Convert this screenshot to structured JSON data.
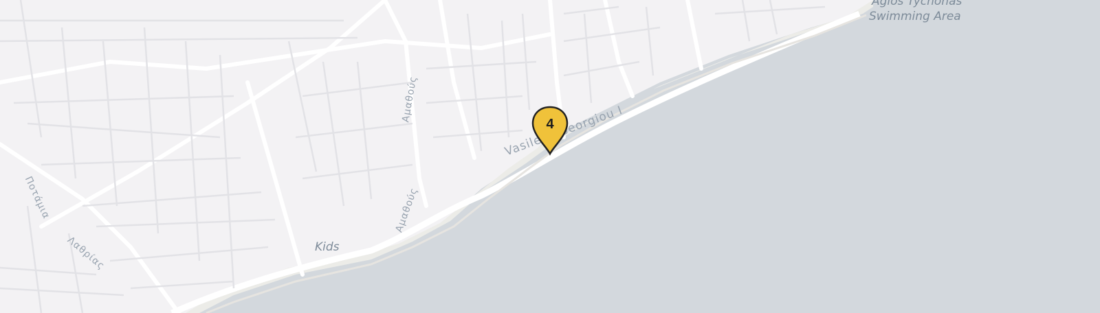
{
  "map": {
    "colors": {
      "water": "#d3d8dd",
      "land": "#f3f2f4",
      "road": "#ffffff",
      "marker_fill": "#f0c23a",
      "marker_stroke": "#222222"
    },
    "labels": {
      "place_top": "Agios Tychonas",
      "place_area": "Swimming Area",
      "kids": "Kids",
      "road_main": "Vasileos Georgiou I",
      "road_vert1": "Αμαθούς",
      "road_vert2": "Αμαθούς",
      "road_left1": "Ποτάμια",
      "road_left2": "Λαθρίας"
    },
    "marker": {
      "count": "4",
      "icon": "map-pin-icon"
    }
  }
}
